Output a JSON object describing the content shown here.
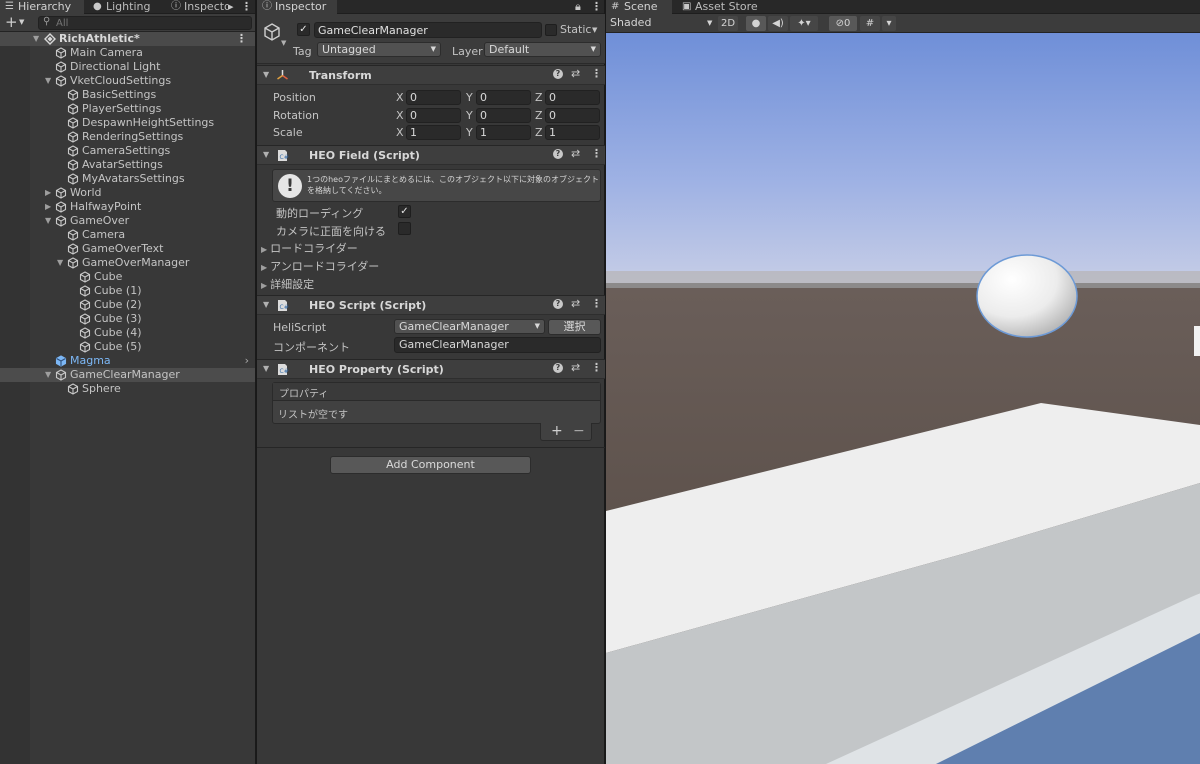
{
  "hierarchy": {
    "tabs": [
      {
        "label": "Hierarchy",
        "icon": "list-icon"
      },
      {
        "label": "Lighting",
        "icon": "lightbulb-icon"
      },
      {
        "label": "Inspecto",
        "icon": "info-icon"
      }
    ],
    "add_label": "+",
    "search_placeholder": "All",
    "scene_name": "RichAthletic*",
    "items": [
      {
        "label": "Main Camera",
        "depth": 1,
        "fold": ""
      },
      {
        "label": "Directional Light",
        "depth": 1,
        "fold": ""
      },
      {
        "label": "VketCloudSettings",
        "depth": 1,
        "fold": "open"
      },
      {
        "label": "BasicSettings",
        "depth": 2,
        "fold": ""
      },
      {
        "label": "PlayerSettings",
        "depth": 2,
        "fold": ""
      },
      {
        "label": "DespawnHeightSettings",
        "depth": 2,
        "fold": ""
      },
      {
        "label": "RenderingSettings",
        "depth": 2,
        "fold": ""
      },
      {
        "label": "CameraSettings",
        "depth": 2,
        "fold": ""
      },
      {
        "label": "AvatarSettings",
        "depth": 2,
        "fold": ""
      },
      {
        "label": "MyAvatarsSettings",
        "depth": 2,
        "fold": ""
      },
      {
        "label": "World",
        "depth": 1,
        "fold": "closed"
      },
      {
        "label": "HalfwayPoint",
        "depth": 1,
        "fold": "closed"
      },
      {
        "label": "GameOver",
        "depth": 1,
        "fold": "open"
      },
      {
        "label": "Camera",
        "depth": 2,
        "fold": ""
      },
      {
        "label": "GameOverText",
        "depth": 2,
        "fold": ""
      },
      {
        "label": "GameOverManager",
        "depth": 2,
        "fold": "open"
      },
      {
        "label": "Cube",
        "depth": 3,
        "fold": ""
      },
      {
        "label": "Cube (1)",
        "depth": 3,
        "fold": ""
      },
      {
        "label": "Cube (2)",
        "depth": 3,
        "fold": ""
      },
      {
        "label": "Cube (3)",
        "depth": 3,
        "fold": ""
      },
      {
        "label": "Cube (4)",
        "depth": 3,
        "fold": ""
      },
      {
        "label": "Cube (5)",
        "depth": 3,
        "fold": ""
      },
      {
        "label": "Magma",
        "depth": 1,
        "fold": "",
        "prefab": true
      },
      {
        "label": "GameClearManager",
        "depth": 1,
        "fold": "open",
        "selected": true
      },
      {
        "label": "Sphere",
        "depth": 2,
        "fold": ""
      }
    ]
  },
  "inspector": {
    "tab_label": "Inspector",
    "object_name": "GameClearManager",
    "active": true,
    "static_label": "Static",
    "tag_label": "Tag",
    "tag_value": "Untagged",
    "layer_label": "Layer",
    "layer_value": "Default",
    "transform": {
      "title": "Transform",
      "rows": [
        {
          "label": "Position",
          "x": "0",
          "y": "0",
          "z": "0"
        },
        {
          "label": "Rotation",
          "x": "0",
          "y": "0",
          "z": "0"
        },
        {
          "label": "Scale",
          "x": "1",
          "y": "1",
          "z": "1"
        }
      ],
      "axis_x": "X",
      "axis_y": "Y",
      "axis_z": "Z"
    },
    "heo_field": {
      "title": "HEO Field (Script)",
      "help_text": "1つのheoファイルにまとめるには、このオブジェクト以下に対象のオブジェクトを格納してください。",
      "dynamic_loading_label": "動的ローディング",
      "dynamic_loading_checked": true,
      "face_camera_label": "カメラに正面を向ける",
      "face_camera_checked": false,
      "foldouts": [
        "ロードコライダー",
        "アンロードコライダー",
        "詳細設定"
      ]
    },
    "heo_script": {
      "title": "HEO Script (Script)",
      "heliscript_label": "HeliScript",
      "heliscript_value": "GameClearManager",
      "select_button": "選択",
      "component_label": "コンポーネント",
      "component_value": "GameClearManager"
    },
    "heo_property": {
      "title": "HEO Property (Script)",
      "list_header": "プロパティ",
      "list_empty": "リストが空です",
      "add_label": "+",
      "remove_label": "−"
    },
    "add_component_label": "Add Component"
  },
  "scene": {
    "tabs": [
      {
        "label": "Scene",
        "icon": "grid-icon"
      },
      {
        "label": "Asset Store",
        "icon": "store-icon"
      }
    ],
    "shading_mode": "Shaded",
    "toggle_2d": "2D",
    "hidden_count": "0"
  }
}
